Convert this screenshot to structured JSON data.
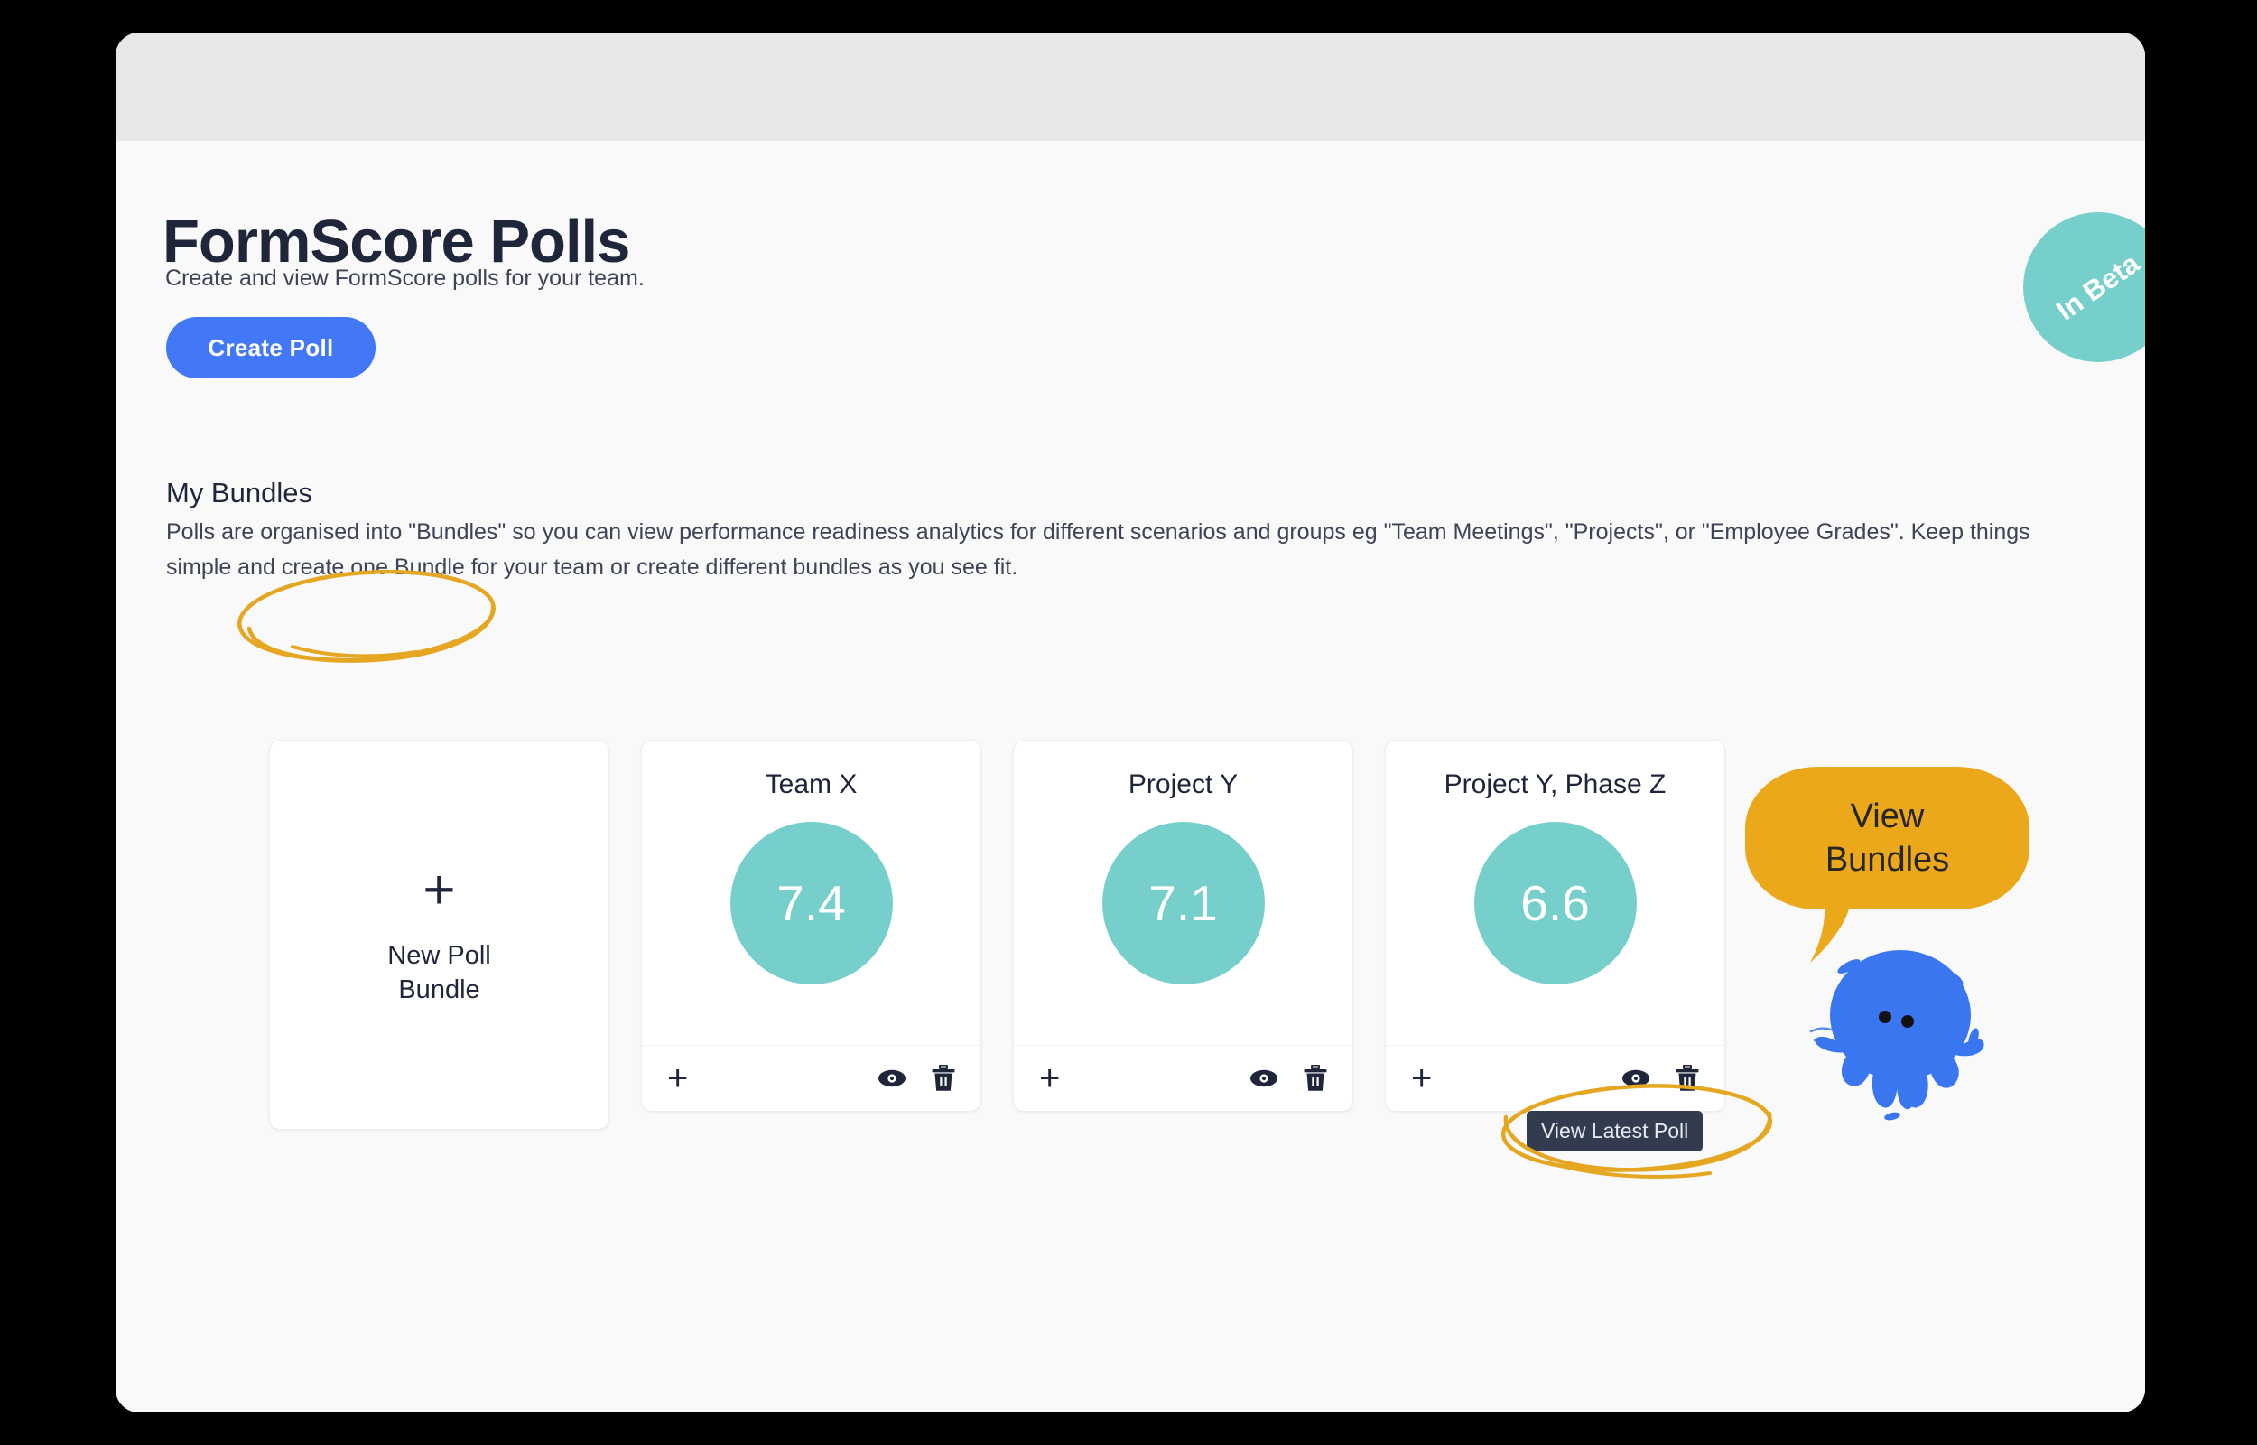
{
  "window": {
    "titlebar_empty": true
  },
  "header": {
    "title": "FormScore Polls",
    "subtitle": "Create and view FormScore polls for your team.",
    "create_button": "Create Poll",
    "beta_badge": "In Beta"
  },
  "bundles_section": {
    "heading": "My Bundles",
    "description": "Polls are organised into \"Bundles\" so you can view performance readiness analytics for different scenarios and groups eg \"Team Meetings\", \"Projects\", or \"Employee Grades\". Keep things simple and create one Bundle for your team or create different bundles as you see fit.",
    "new_bundle_card": {
      "icon": "plus-icon",
      "label_line1": "New Poll",
      "label_line2": "Bundle"
    },
    "cards": [
      {
        "title": "Team X",
        "score": "7.4",
        "add_icon": "plus-icon",
        "view_icon": "eye-icon",
        "delete_icon": "trash-icon"
      },
      {
        "title": "Project Y",
        "score": "7.1",
        "add_icon": "plus-icon",
        "view_icon": "eye-icon",
        "delete_icon": "trash-icon"
      },
      {
        "title": "Project Y, Phase Z",
        "score": "6.6",
        "add_icon": "plus-icon",
        "view_icon": "eye-icon",
        "delete_icon": "trash-icon"
      }
    ]
  },
  "tooltip": {
    "text": "View Latest Poll"
  },
  "callout": {
    "bubble_line1": "View",
    "bubble_line2": "Bundles",
    "mascot": "octopus-mascot"
  },
  "annotations": [
    {
      "name": "ellipse-my-bundles",
      "shape": "hand-drawn-ellipse"
    },
    {
      "name": "ellipse-view-latest-poll",
      "shape": "hand-drawn-ellipse"
    }
  ],
  "colors": {
    "accent_blue": "#4277f5",
    "teal": "#76cfca",
    "amber": "#eba81b",
    "annotation_gold": "#e5a722",
    "tooltip_bg": "#333c4e",
    "text_dark": "#20263a",
    "mascot_blue": "#3a76f0"
  }
}
